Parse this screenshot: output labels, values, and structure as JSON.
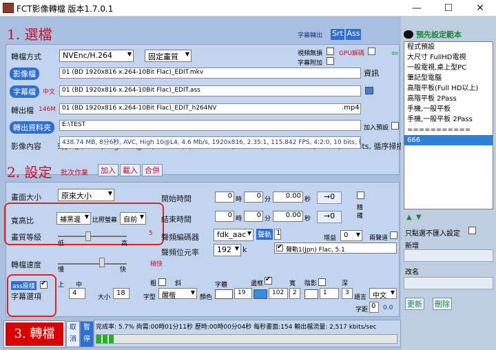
{
  "window": {
    "title": "FCT影像轉檔 版本1.7.0.1",
    "minimize": "—",
    "maximize": "☐",
    "close": "✕"
  },
  "section1": {
    "title": "1. 選檔",
    "subtitle_label": "字幕轉出",
    "srt": "Srt",
    "ass": "Ass",
    "convert_label": "轉檔方式",
    "encoder": "NVEnc/H.264",
    "quality": "固定畫質",
    "video_no_sound": "視頻無損",
    "gpu_decode": "GPU解碼",
    "subtitle_append": "字幕附加",
    "video_label": "影像檔",
    "video_value": "01 (BD 1920x816 x.264-10Bit Flac)_EDIT.mkv",
    "info_btn": "資訊",
    "sub_label": "字幕檔",
    "sub_lang": "中文",
    "sub_value": "01 (BD 1920x816 x.264-10Bit Flac)_EDIT.ass",
    "out_label": "轉出檔",
    "out_size": "146M",
    "out_value": "01 (BD 1920x816 x.264-10Bit Flac)_EDIT_h264NV",
    "out_ext": ".mp4",
    "folder_label": "轉出資料夾",
    "folder_value": "E:\\TEST",
    "add_preset": "加入預設",
    "content_label": "影像內容",
    "content_value": "438.74 MB, 8分6秒, AVC, High 10@L4, 4.6 Mb/s, 1920x816, 2.35:1, 115.842 FPS, 4:2:0, 10 bits, 循序掃描"
  },
  "section2": {
    "title": "2. 設定",
    "batch": "批次作業",
    "add": "加入",
    "load": "載入",
    "merge": "合併",
    "size_label": "畫面大小",
    "size_value": "原來大小",
    "aspect_label": "寬高比",
    "aspect_value": "補黑邊",
    "ratio_label": "比照螢幕",
    "ratio_value": "自前",
    "quality_label": "畫質等級",
    "quality_low": "低",
    "quality_high": "高",
    "quality_num": "5",
    "speed_label": "轉檔速度",
    "speed_low": "慢",
    "speed_high": "快",
    "speed_note": "稍快",
    "start_label": "開始時間",
    "end_label": "結束時間",
    "hour": "時",
    "minute": "分",
    "second": "秒",
    "zero": "0",
    "zero_dec": "0.00",
    "go_btn": "→0",
    "precise": "精確",
    "audio_codec_label": "聲頻編碼器",
    "audio_codec": "fdk_aac",
    "audio_track_label": "聲軌",
    "audio_track_num": "1",
    "gain_label": "增益",
    "gain_value": "0",
    "dual": "兩聲道",
    "bitrate_label": "聲頻位元率",
    "bitrate_value": "192",
    "bitrate_unit": "k",
    "track_desc": "聲軌1(Jpn) Flac, 5.1",
    "ass_orig": "ass原樣",
    "sub_option": "字幕選項",
    "bold": "粗",
    "italic": "斜",
    "font": "字體",
    "outline": "邊框",
    "wide": "寬",
    "shadow": "陰影",
    "deep": "深",
    "align_up": "上",
    "align_mid": "中",
    "pos_label": "位置",
    "pos_value": "4",
    "size_l": "大小",
    "size_v": "18",
    "font_type": "字型",
    "font_name": "醒楷",
    "color": "顏色",
    "color_v": "19",
    "color2_v": "102",
    "w_v": "2",
    "s_v": "1",
    "d_v": "3",
    "lang_label": "語言",
    "lang_value": "中文",
    "font_label": "字距",
    "font_value": "0",
    "font_num": "0.0",
    "preview": "字幕預覽"
  },
  "section3": {
    "title": "3. 轉檔",
    "cancel": "取消",
    "pause": "暫停",
    "status": "完成率: 5.7% 尚需:00時01分11秒 歷時:00時00分04秒 每秒畫面:154 輸出檔流量: 2,517 kbits/sec",
    "progress": 0.057
  },
  "presets": {
    "title": "預先設定範本",
    "items": [
      "程式預設",
      "大尺寸 FullHD電視",
      "一般電視,桌上型PC",
      "筆記型電腦",
      "高階平板(Full HD以上)",
      "高階平板 2Pass",
      "手機,一般平板",
      "手機,一般平板 2Pass",
      "===========",
      "666"
    ],
    "selected": "666",
    "only_option": "只點選不匯入設定",
    "new_label": "新增",
    "rename_label": "改名",
    "update": "更新",
    "delete": "刪除"
  }
}
